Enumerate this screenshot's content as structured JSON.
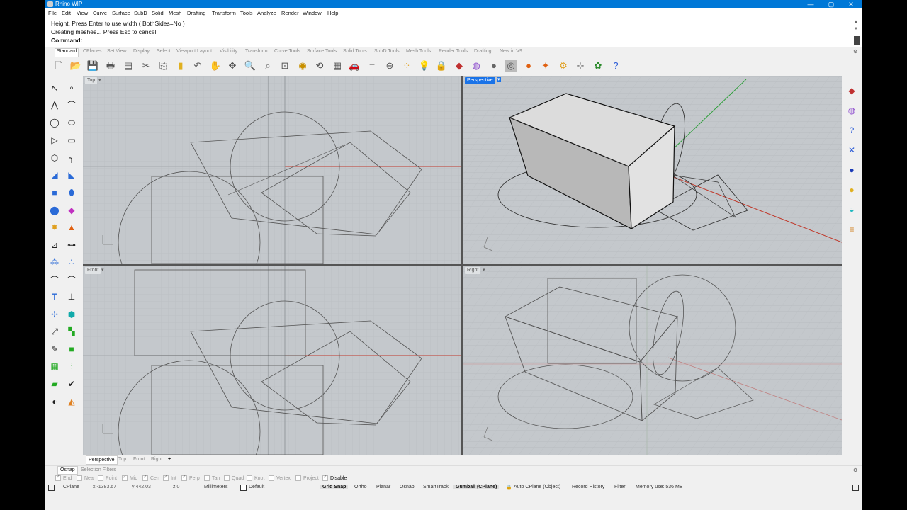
{
  "app": {
    "title": "Rhino WIP",
    "window_buttons": [
      "—",
      "▢",
      "✕"
    ]
  },
  "menu": [
    "File",
    "Edit",
    "View",
    "Curve",
    "Surface",
    "SubD",
    "Solid",
    "Mesh",
    "Drafting",
    "Transform",
    "Tools",
    "Analyze",
    "Render",
    "Window",
    "Help"
  ],
  "command": {
    "history_line1": "Height. Press Enter to use width ( BothSides=No )",
    "history_line2": "Creating meshes... Press Esc to cancel",
    "prompt": "Command:"
  },
  "toolbar_tabs": [
    "Standard",
    "CPlanes",
    "Set View",
    "Display",
    "Select",
    "Viewport Layout",
    "Visibility",
    "Transform",
    "Curve Tools",
    "Surface Tools",
    "Solid Tools",
    "SubD Tools",
    "Mesh Tools",
    "Render Tools",
    "Drafting",
    "New in V9"
  ],
  "viewports": {
    "top": {
      "label": "Top"
    },
    "perspective": {
      "label": "Perspective"
    },
    "front": {
      "label": "Front"
    },
    "right": {
      "label": "Right"
    }
  },
  "viewport_tabs": [
    "Perspective",
    "Top",
    "Front",
    "Right",
    "+"
  ],
  "osnap_tabs": [
    "Osnap",
    "Selection Filters"
  ],
  "osnap_items": [
    {
      "label": "End",
      "checked": true
    },
    {
      "label": "Near",
      "checked": false
    },
    {
      "label": "Point",
      "checked": false
    },
    {
      "label": "Mid",
      "checked": true
    },
    {
      "label": "Cen",
      "checked": true
    },
    {
      "label": "Int",
      "checked": true
    },
    {
      "label": "Perp",
      "checked": true
    },
    {
      "label": "Tan",
      "checked": false
    },
    {
      "label": "Quad",
      "checked": false
    },
    {
      "label": "Knot",
      "checked": false
    },
    {
      "label": "Vertex",
      "checked": false
    },
    {
      "label": "Project",
      "checked": false
    },
    {
      "label": "Disable",
      "checked": true
    }
  ],
  "status": {
    "cplane": "CPlane",
    "x": "x -1383.67",
    "y": "y 442.03",
    "z": "z 0",
    "units": "Millimeters",
    "layer": "Default",
    "grid_snap": "Grid Snap",
    "ortho": "Ortho",
    "planar": "Planar",
    "osnap": "Osnap",
    "smarttrack": "SmartTrack",
    "gumball": "Gumball (CPlane)",
    "auto_cplane": "Auto CPlane (Object)",
    "record_history": "Record History",
    "filter": "Filter",
    "memory": "Memory use: 536 MB"
  },
  "colors": {
    "titlebar": "#0078d7",
    "x_axis": "#c0392b",
    "y_axis": "#2e9e3a",
    "viewport_bg": "#c4c8cc",
    "active_label": "#1a73e8"
  }
}
